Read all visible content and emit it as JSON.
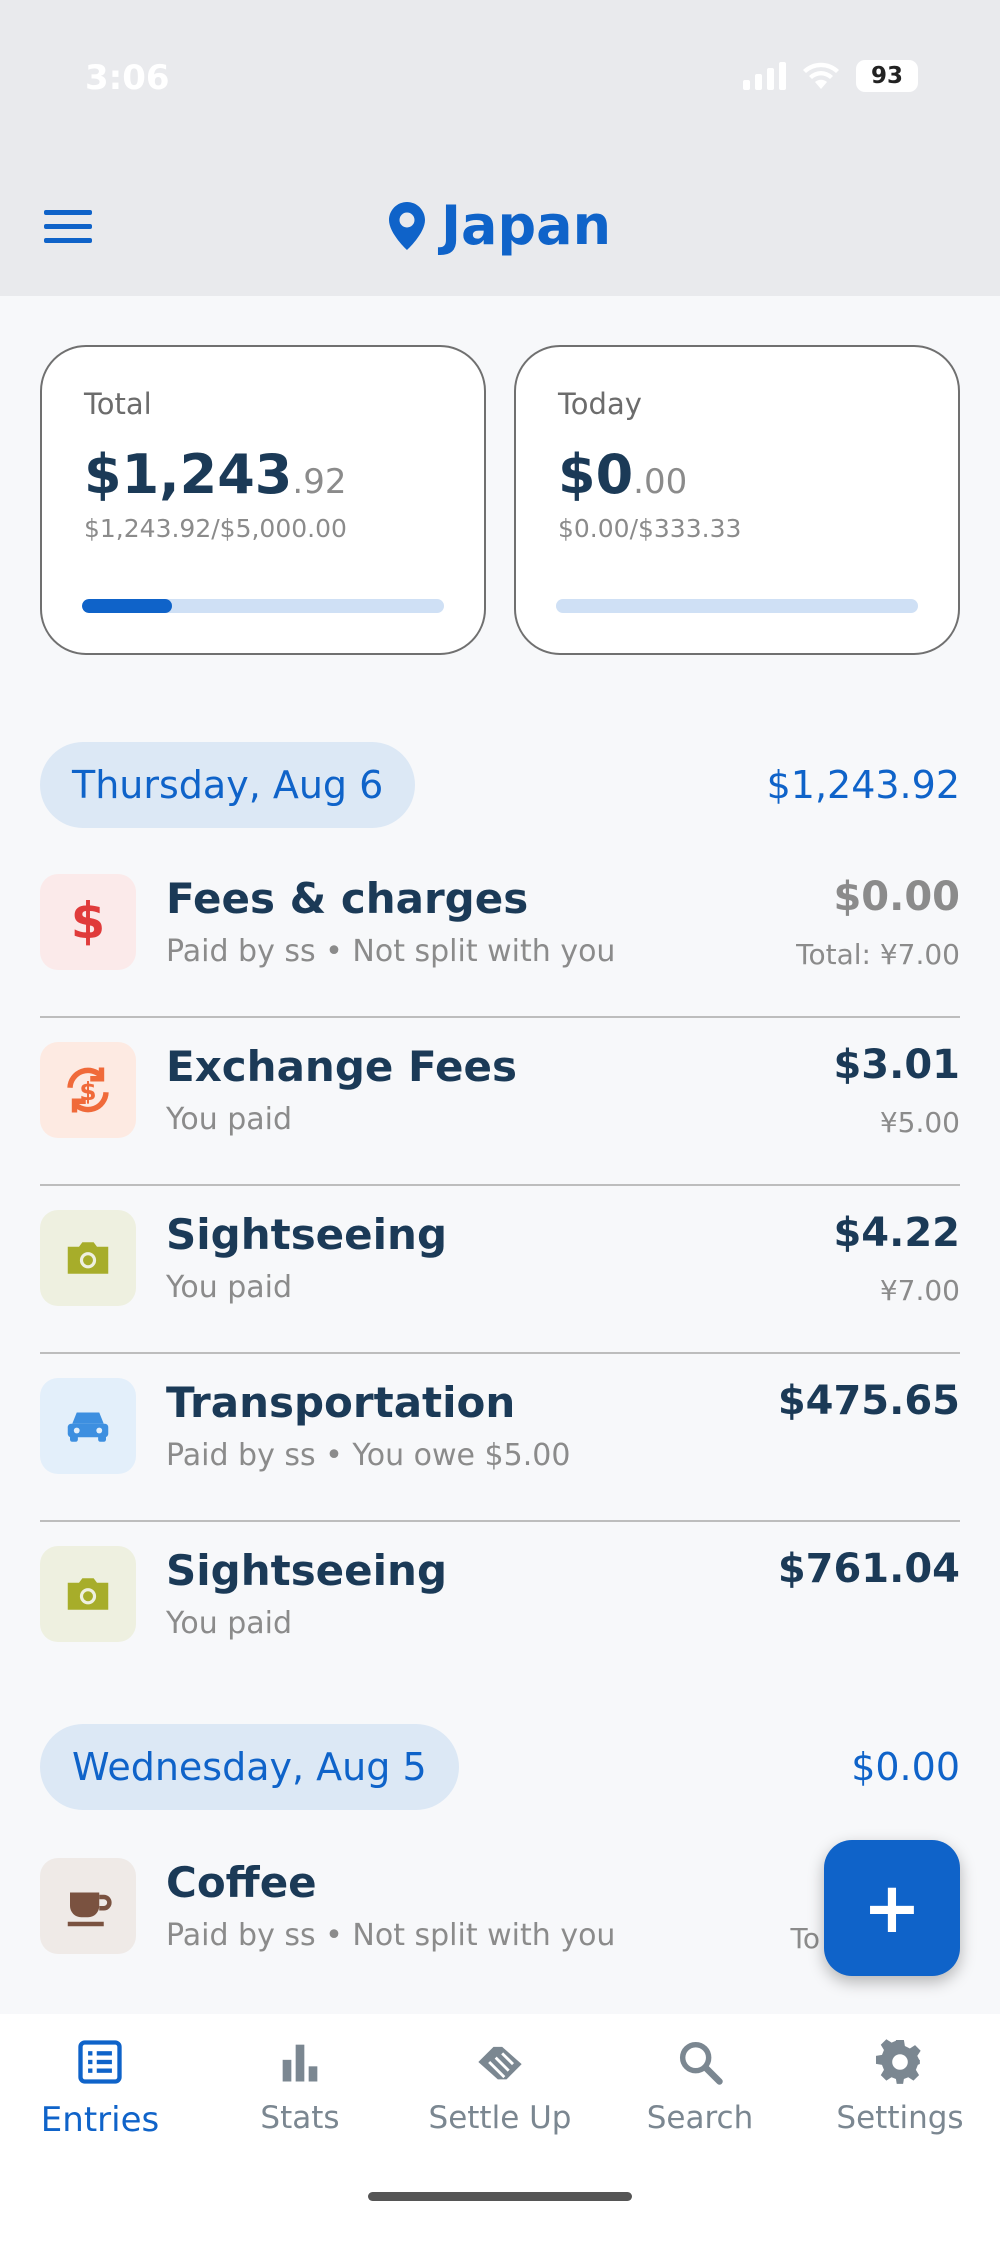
{
  "status": {
    "time": "3:06",
    "battery": "93"
  },
  "header": {
    "title": "Japan"
  },
  "summary": {
    "total": {
      "label": "Total",
      "dollars": "$1,243",
      "cents": ".92",
      "sub": "$1,243.92/$5,000.00",
      "progress": 0.249
    },
    "today": {
      "label": "Today",
      "dollars": "$0",
      "cents": ".00",
      "sub": "$0.00/$333.33",
      "progress": 0.0
    }
  },
  "days": [
    {
      "date": "Thursday, Aug 6",
      "total": "$1,243.92",
      "entries": [
        {
          "icon": "dollar-icon",
          "name": "Fees & charges",
          "sub": "Paid by ss • Not split with you",
          "amount": "$0.00",
          "total": "Total: ¥7.00"
        },
        {
          "icon": "exchange-icon",
          "name": "Exchange Fees",
          "sub": "You paid",
          "amount": "$3.01",
          "total": "¥5.00"
        },
        {
          "icon": "camera-icon",
          "name": "Sightseeing",
          "sub": "You paid",
          "amount": "$4.22",
          "total": "¥7.00"
        },
        {
          "icon": "car-icon",
          "name": "Transportation",
          "sub": "Paid by ss • You owe $5.00",
          "amount": "$475.65",
          "total": ""
        },
        {
          "icon": "camera-icon",
          "name": "Sightseeing",
          "sub": "You paid",
          "amount": "$761.04",
          "total": ""
        }
      ]
    },
    {
      "date": "Wednesday, Aug 5",
      "total": "$0.00",
      "entries": [
        {
          "icon": "coffee-icon",
          "name": "Coffee",
          "sub": "Paid by ss • Not split with you",
          "amount": "",
          "total": "To"
        }
      ]
    }
  ],
  "fab": {
    "icon": "plus-icon",
    "label": "+"
  },
  "tabs": [
    {
      "icon": "list-icon",
      "label": "Entries",
      "active": true
    },
    {
      "icon": "bar-chart-icon",
      "label": "Stats"
    },
    {
      "icon": "handshake-icon",
      "label": "Settle Up"
    },
    {
      "icon": "search-icon",
      "label": "Search"
    },
    {
      "icon": "gear-icon",
      "label": "Settings"
    }
  ],
  "colors": {
    "accent": "#0f63c9",
    "text": "#1b3a57",
    "muted": "#8b8b8b",
    "pill": "#dce8f5"
  }
}
